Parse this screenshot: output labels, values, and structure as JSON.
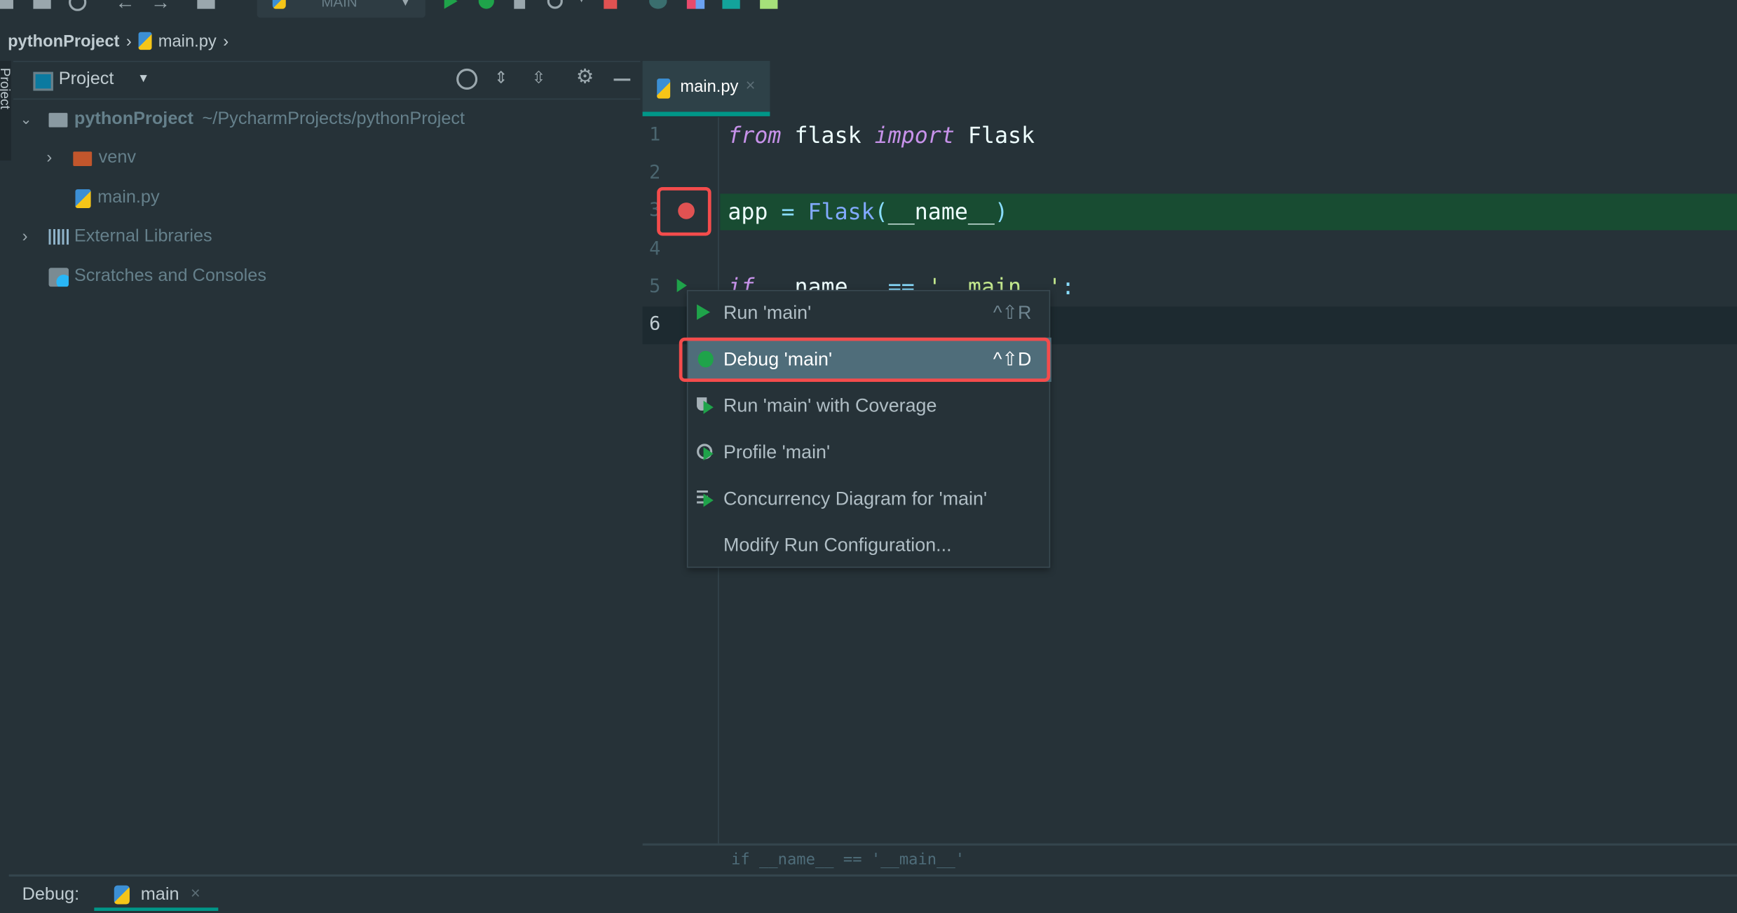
{
  "toolbar": {
    "run_config": "MAIN"
  },
  "breadcrumb": {
    "project": "pythonProject",
    "file": "main.py"
  },
  "side_strip": {
    "label": "Project"
  },
  "project_panel": {
    "title": "Project",
    "tree": [
      {
        "label": "pythonProject",
        "path": "~/PycharmProjects/pythonProject",
        "icon": "folder-icon",
        "expanded": true
      },
      {
        "label": "venv",
        "icon": "folder-icon",
        "expanded": false
      },
      {
        "label": "main.py",
        "icon": "python-file-icon"
      },
      {
        "label": "External Libraries",
        "icon": "library-icon",
        "expanded": false
      },
      {
        "label": "Scratches and Consoles",
        "icon": "scratches-icon"
      }
    ]
  },
  "editor": {
    "tab": "main.py",
    "line_numbers": [
      "1",
      "2",
      "3",
      "4",
      "5",
      "6"
    ],
    "lines": {
      "l1": {
        "a": "from",
        "b": " flask ",
        "c": "import",
        "d": " Flask"
      },
      "l3": {
        "a": "app ",
        "b": "=",
        "c": " Flask",
        "d": "(",
        "e": "__name__",
        "f": ")"
      },
      "l5": {
        "a": "if",
        "b": " __name__ ",
        "c": "==",
        "d": " '__main__'",
        "e": ":"
      }
    },
    "breakpoint_line": 3,
    "current_line": 6,
    "breadcrumb_hint": "if __name__ == '__main__'"
  },
  "context_menu": {
    "items": [
      {
        "label": "Run 'main'",
        "shortcut": "^⇧R",
        "icon": "run-icon"
      },
      {
        "label": "Debug 'main'",
        "shortcut": "^⇧D",
        "icon": "debug-icon",
        "selected": true
      },
      {
        "label": "Run 'main' with Coverage",
        "icon": "coverage-icon"
      },
      {
        "label": "Profile 'main'",
        "icon": "profile-icon"
      },
      {
        "label": "Concurrency Diagram for 'main'",
        "icon": "concurrency-icon"
      },
      {
        "label": "Modify Run Configuration...",
        "icon": ""
      }
    ]
  },
  "bottom": {
    "label": "Debug:",
    "tab": "main"
  },
  "colors": {
    "accent": "#009688",
    "highlight_box": "#f44c4c",
    "breakpoint": "#e05252",
    "selection": "#4f6d7a"
  }
}
